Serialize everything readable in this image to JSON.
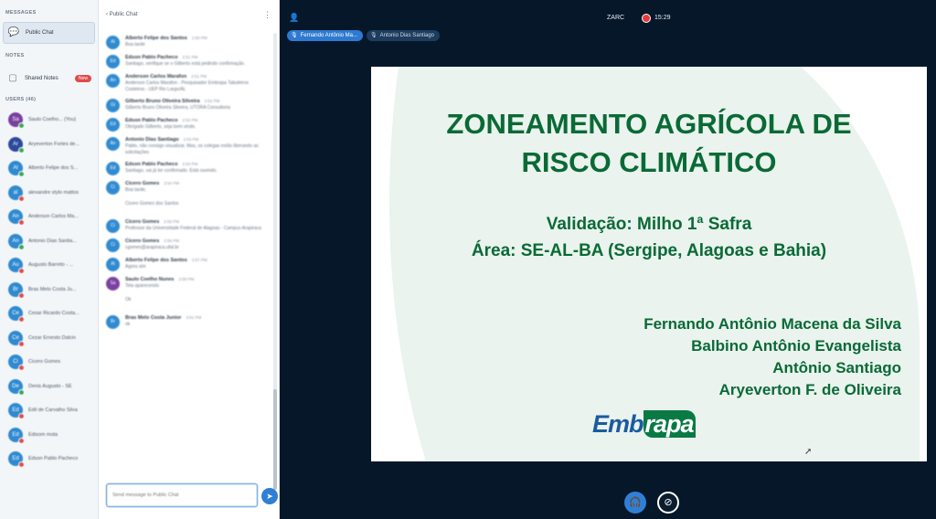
{
  "sidebar": {
    "messages_label": "MESSAGES",
    "public_chat": "Public Chat",
    "notes_label": "NOTES",
    "shared_notes": "Shared Notes",
    "shared_notes_badge": "New",
    "users_label": "USERS (46)",
    "users": [
      {
        "initials": "Sa",
        "name": "Saulo Coelho... (You)",
        "color": "#7a3fa0",
        "status": "#3aa65a"
      },
      {
        "initials": "Ar",
        "name": "Aryeverton Fortes de...",
        "color": "#2b4a9a",
        "status": "#3aa65a"
      },
      {
        "initials": "Al",
        "name": "Alberto Felipe dos S...",
        "color": "#2f8ad0",
        "status": "#3aa65a"
      },
      {
        "initials": "al",
        "name": "alexandre stylo mattos",
        "color": "#2f8ad0",
        "status": "#e04b4b"
      },
      {
        "initials": "An",
        "name": "Anderson Carlos Ma...",
        "color": "#2f8ad0",
        "status": "#e04b4b"
      },
      {
        "initials": "An",
        "name": "Antonio Dias Santia...",
        "color": "#2f8ad0",
        "status": "#3aa65a"
      },
      {
        "initials": "Au",
        "name": "Augusto Barreto - ...",
        "color": "#2f8ad0",
        "status": "#e04b4b"
      },
      {
        "initials": "Br",
        "name": "Bras Melo Costa Ju...",
        "color": "#2f8ad0",
        "status": "#e04b4b"
      },
      {
        "initials": "Ce",
        "name": "Cesar Ricardo Costa...",
        "color": "#2f8ad0",
        "status": "#e04b4b"
      },
      {
        "initials": "Ce",
        "name": "Cezar Ernesto Dalcin",
        "color": "#2f8ad0",
        "status": "#e04b4b"
      },
      {
        "initials": "Ci",
        "name": "Cicero Gomes",
        "color": "#2f8ad0",
        "status": "#e04b4b"
      },
      {
        "initials": "De",
        "name": "Denis Augusto - SE",
        "color": "#2f8ad0",
        "status": "#3aa65a"
      },
      {
        "initials": "Ed",
        "name": "Edil de Carvalho Silva",
        "color": "#2f8ad0",
        "status": "#e04b4b"
      },
      {
        "initials": "Ed",
        "name": "Edisom mota",
        "color": "#2f8ad0",
        "status": "#e04b4b"
      },
      {
        "initials": "Ed",
        "name": "Edson Pablo Pacheco",
        "color": "#2f8ad0",
        "status": "#e04b4b"
      }
    ]
  },
  "chat": {
    "back_label": "Public Chat",
    "input_placeholder": "Send message to Public Chat",
    "messages": [
      {
        "initials": "Al",
        "color": "#2f8ad0",
        "name": "Alberto Felipe dos Santos",
        "time": "2:50 PM",
        "text": "Boa tarde"
      },
      {
        "initials": "Ed",
        "color": "#2f8ad0",
        "name": "Edson Pablo Pacheco",
        "time": "2:51 PM",
        "text": "Santiago, verifique se o Gilberto está pedindo confirmação."
      },
      {
        "initials": "An",
        "color": "#2f8ad0",
        "name": "Anderson Carlos Marafon",
        "time": "2:51 PM",
        "text": "Anderson Carlos Marafon - Pesquisador Embrapa Tabuleiros Costeiros - UEP Rio Largo/AL"
      },
      {
        "initials": "Gi",
        "color": "#2f8ad0",
        "name": "Gilberto Bruno Oliveira Silveira",
        "time": "2:52 PM",
        "text": "Gilberto Bruno Oliveira Silveira, UTORA Consultoria"
      },
      {
        "initials": "Ed",
        "color": "#2f8ad0",
        "name": "Edson Pablo Pacheco",
        "time": "2:52 PM",
        "text": "Obrigado Gilberto, seja bem vindo."
      },
      {
        "initials": "An",
        "color": "#2f8ad0",
        "name": "Antonio Dias Santiago",
        "time": "2:53 PM",
        "text": "Pablo, não consigo visualizar. Mas, os colegas estão liberando as solicitações"
      },
      {
        "initials": "Ed",
        "color": "#2f8ad0",
        "name": "Edson Pablo Pacheco",
        "time": "2:53 PM",
        "text": "Santiago, vai já ter confirmado. Está ouvindo."
      },
      {
        "initials": "Ci",
        "color": "#2f8ad0",
        "name": "Cicero Gomes",
        "time": "2:54 PM",
        "text": "Boa tarde,"
      },
      {
        "initials": "Ci",
        "color": "#2f8ad0",
        "name": "",
        "time": "",
        "text": "Cicero Gomes dos Santos"
      },
      {
        "initials": "Ci",
        "color": "#2f8ad0",
        "name": "Cicero Gomes",
        "time": "2:55 PM",
        "text": "Professor da Universidade Federal de Alagoas - Campus Arapiraca"
      },
      {
        "initials": "Ci",
        "color": "#2f8ad0",
        "name": "Cicero Gomes",
        "time": "2:56 PM",
        "text": "cgomes@arapiraca.ufal.br"
      },
      {
        "initials": "Al",
        "color": "#2f8ad0",
        "name": "Alberto Felipe dos Santos",
        "time": "2:57 PM",
        "text": "Agora sim"
      },
      {
        "initials": "Sa",
        "color": "#7a3fa0",
        "name": "Saulo Coelho Nunes",
        "time": "2:59 PM",
        "text": "Tela aparecendo"
      },
      {
        "initials": "Sa",
        "color": "#7a3fa0",
        "name": "",
        "time": "",
        "text": "Ok"
      },
      {
        "initials": "Br",
        "color": "#2f8ad0",
        "name": "Bras Melo Costa Junior",
        "time": "3:01 PM",
        "text": "ok"
      }
    ]
  },
  "main": {
    "conference_title": "ZARC",
    "elapsed_time": "15:29",
    "talkers": [
      "Fernando Antônio Ma...",
      "Antonio Dias Santiago"
    ],
    "slide": {
      "title_line1": "ZONEAMENTO AGRÍCOLA DE",
      "title_line2": "RISCO CLIMÁTICO",
      "subtitle_line1": "Validação: Milho 1ª Safra",
      "subtitle_line2": "Área: SE-AL-BA (Sergipe, Alagoas e Bahia)",
      "authors": [
        "Fernando Antônio Macena da Silva",
        "Balbino Antônio Evangelista",
        "Antônio Santiago",
        "Aryeverton F. de Oliveira"
      ],
      "logo_part1": "Emb",
      "logo_part2": "rapa"
    },
    "icons": {
      "user": "user-icon",
      "audio": "headphones-icon",
      "camera": "camera-off-icon"
    }
  }
}
